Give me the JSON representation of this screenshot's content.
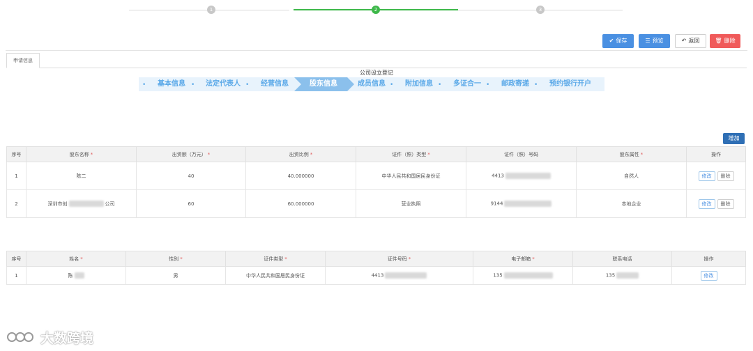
{
  "stepper": {
    "steps": [
      "1",
      "2",
      "3"
    ],
    "active_index": 1
  },
  "toolbar": {
    "save": "保存",
    "preview": "预览",
    "back": "返回",
    "delete": "删除"
  },
  "tab": {
    "label": "申请信息"
  },
  "form": {
    "title": "公司设立登记"
  },
  "process": {
    "items": [
      "基本信息",
      "法定代表人",
      "经营信息",
      "股东信息",
      "成员信息",
      "附加信息",
      "多证合一",
      "邮政寄递",
      "预约银行开户"
    ],
    "active": "股东信息"
  },
  "shareholders": {
    "add_label": "增加",
    "headers": [
      "序号",
      "股东名称",
      "出资额（万元）",
      "出资比例",
      "证件（照）类型",
      "证件（照）号码",
      "股东属性",
      "操作"
    ],
    "required": [
      false,
      true,
      true,
      true,
      true,
      false,
      true,
      false
    ],
    "rows": [
      {
        "no": "1",
        "name": "陈二",
        "amount": "40",
        "ratio": "40.000000",
        "id_type": "中华人民共和国居民身份证",
        "id_no": "4413",
        "attr": "自然人"
      },
      {
        "no": "2",
        "name_prefix": "深圳市创",
        "name_suffix": "公司",
        "amount": "60",
        "ratio": "60.000000",
        "id_type": "营业执照",
        "id_no": "9144",
        "attr": "本地企业"
      }
    ],
    "edit_label": "修改",
    "delete_label": "删除"
  },
  "members": {
    "headers": [
      "序号",
      "姓名",
      "性别",
      "证件类型",
      "证件号码",
      "电子邮箱",
      "联系电话",
      "操作"
    ],
    "required": [
      false,
      true,
      true,
      true,
      true,
      true,
      false,
      false
    ],
    "rows": [
      {
        "no": "1",
        "name": "陈",
        "gender": "男",
        "id_type": "中华人民共和国居民身份证",
        "id_no": "4413",
        "email": "135",
        "phone": "135"
      }
    ],
    "edit_label": "修改"
  },
  "watermark": {
    "text": "大数跨境"
  }
}
